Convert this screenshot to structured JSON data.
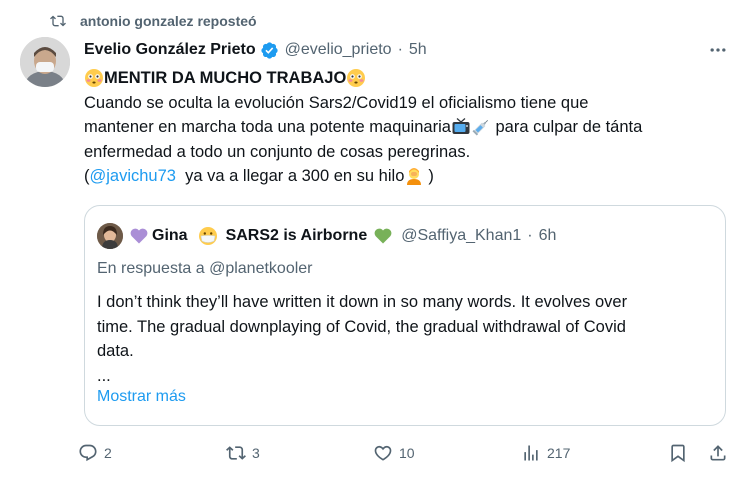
{
  "repost": {
    "icon": "repost-icon",
    "text": "antonio gonzalez reposteó"
  },
  "tweet": {
    "author_name": "Evelio González Prieto",
    "handle": "@evelio_prieto",
    "dot": "·",
    "time": "5h",
    "verified_icon": "verified-badge-icon",
    "more_icon": "more-options-icon",
    "headline": "MENTIR DA MUCHO TRABAJO",
    "line2": "Cuando se oculta la evolución Sars2/Covid19 el oficialismo tiene que",
    "line3a": "mantener en marcha toda una potente maquinaria",
    "line3b": " para culpar de tánta",
    "line4": "enfermedad a todo un conjunto de cosas peregrinas.",
    "line5_open": "(",
    "mention": "@javichu73",
    "line5_rest": "  ya va a llegar a 300 en su hilo",
    "line5_close": ")"
  },
  "quote": {
    "name_part1": "Gina",
    "name_part2": "SARS2 is Airborne",
    "handle": "@Saffiya_Khan1",
    "dot": "·",
    "time": "6h",
    "reply_prefix": "En respuesta a",
    "reply_handle": "@planetkooler",
    "body_line1": "I don’t think they’ll have written it down in so many words. It evolves over",
    "body_line2": "time. The gradual downplaying of Covid, the gradual withdrawal of Covid",
    "body_line3": "data.",
    "ellipsis": "...",
    "show_more": "Mostrar más"
  },
  "actions": {
    "reply_count": "2",
    "repost_count": "3",
    "like_count": "10",
    "views_count": "217"
  },
  "colors": {
    "accent": "#1d9bf0",
    "muted": "#536471",
    "text": "#0f1419",
    "border": "#cfd9de"
  }
}
